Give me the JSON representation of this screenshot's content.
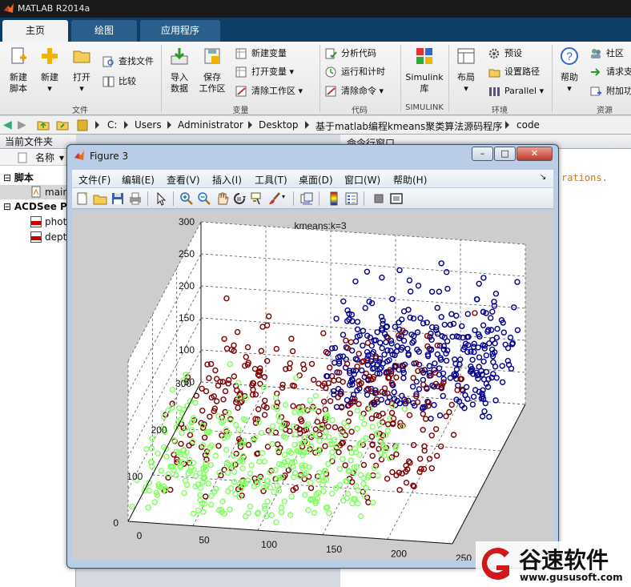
{
  "app": {
    "title": "MATLAB R2014a"
  },
  "tabs": [
    {
      "label": "主页"
    },
    {
      "label": "绘图"
    },
    {
      "label": "应用程序"
    }
  ],
  "ribbon": {
    "new_script": "新建\n脚本",
    "new": "新建",
    "open": "打开",
    "find_files": "查找文件",
    "compare": "比较",
    "import_data": "导入\n数据",
    "save_workspace": "保存\n工作区",
    "new_variable": "新建变量",
    "open_variable": "打开变量",
    "clear_workspace": "清除工作区",
    "analyze_code": "分析代码",
    "run_and_time": "运行和计时",
    "clear_commands": "清除命令",
    "simulink": "Simulink\n库",
    "layout": "布局",
    "preferences": "预设",
    "set_path": "设置路径",
    "parallel": "Parallel",
    "help": "帮助",
    "community": "社区",
    "request_support": "请求支",
    "add_ons": "附加功",
    "sections": {
      "file": "文件",
      "variable": "变量",
      "code": "代码",
      "simulink": "SIMULINK",
      "environment": "环境",
      "resources": "资源"
    }
  },
  "address": {
    "crumbs": [
      "C:",
      "Users",
      "Administrator",
      "Desktop",
      "基于matlab编程kmeans聚类算法源码程序",
      "code"
    ]
  },
  "left_panel": {
    "title": "当前文件夹",
    "column": "名称",
    "items": [
      {
        "label": "脚本"
      },
      {
        "label": "main"
      },
      {
        "label": "ACDSee PI"
      },
      {
        "label": "phot"
      },
      {
        "label": "dept"
      }
    ]
  },
  "right_panel": {
    "title": "命令行窗口",
    "text": "rations."
  },
  "figure": {
    "title": "Figure 3",
    "menu": [
      "文件(F)",
      "编辑(E)",
      "查看(V)",
      "插入(I)",
      "工具(T)",
      "桌面(D)",
      "窗口(W)",
      "帮助(H)"
    ],
    "toolbar_icons": [
      "new-figure-icon",
      "open-file-icon",
      "save-icon",
      "print-icon",
      "pointer-icon",
      "zoom-in-icon",
      "zoom-out-icon",
      "pan-icon",
      "rotate-3d-icon",
      "data-cursor-icon",
      "brush-icon",
      "link-plot-icon",
      "colorbar-icon",
      "legend-icon",
      "hide-plot-tools-icon",
      "show-plot-tools-icon"
    ],
    "window_buttons": {
      "minimize": "–",
      "maximize": "□",
      "close": "✕"
    }
  },
  "chart_data": {
    "type": "scatter",
    "title": "kmeans:k=3",
    "xlabel": "",
    "ylabel": "",
    "zlabel": "",
    "x_ticks": [
      0,
      50,
      100,
      150,
      200,
      250
    ],
    "y_ticks": [
      0,
      100,
      200,
      300
    ],
    "z_ticks": [
      50,
      100,
      150,
      200,
      250,
      300
    ],
    "xlim": [
      0,
      250
    ],
    "ylim": [
      0,
      300
    ],
    "zlim": [
      50,
      300
    ],
    "grid": true,
    "projection": "3d",
    "series": [
      {
        "color": "#00008b",
        "region": {
          "x": [
            120,
            250
          ],
          "y": [
            150,
            300
          ],
          "z": [
            120,
            290
          ]
        }
      },
      {
        "color": "#7f0000",
        "region": {
          "x": [
            20,
            220
          ],
          "y": [
            20,
            280
          ],
          "z": [
            80,
            230
          ]
        }
      },
      {
        "color": "#80ff60",
        "region": {
          "x": [
            0,
            180
          ],
          "y": [
            0,
            200
          ],
          "z": [
            60,
            180
          ]
        }
      }
    ]
  },
  "watermark": {
    "brand": "谷速软件",
    "url": "www.gususoft.com"
  },
  "colors": {
    "titlebar": "#1a1a1a",
    "tabbar": "#0e3d66",
    "ribbon": "#eeeeee",
    "figure_frame": "#b9cee6",
    "plot_bg": "#cdcdcd"
  }
}
